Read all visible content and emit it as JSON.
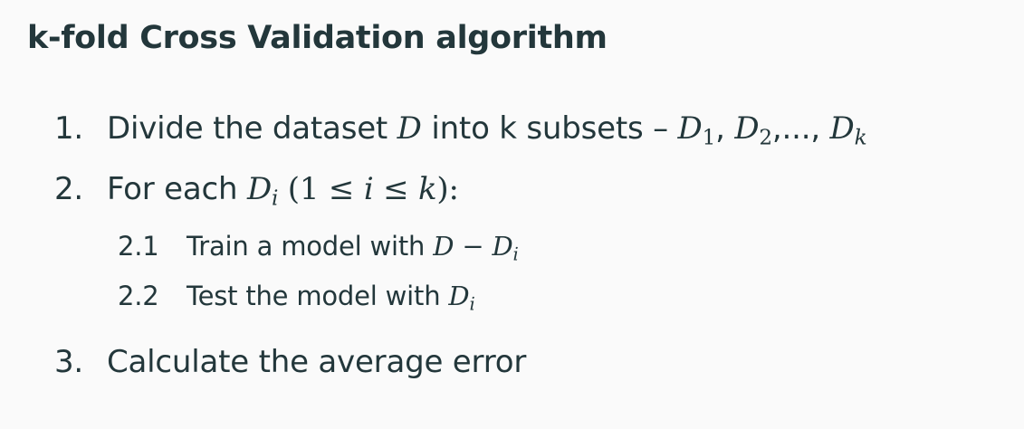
{
  "slide": {
    "title": "k-fold Cross Validation algorithm",
    "steps": [
      {
        "number": "1.",
        "text_a": "Divide the dataset ",
        "math_D": "D",
        "text_b": " into k subsets – ",
        "d1": "D",
        "d1_sub": "1",
        "sep1": ", ",
        "d2": "D",
        "d2_sub": "2",
        "ellipsis": ",..., ",
        "dk": "D",
        "dk_sub": "k"
      },
      {
        "number": "2.",
        "text_a": "For each ",
        "di": "D",
        "di_sub": "i",
        "cond_open": " (1 ≤ ",
        "cond_i": "i",
        "cond_le": " ≤ ",
        "cond_k": "k",
        "cond_close": "):",
        "substeps": [
          {
            "number": "2.1",
            "text": "Train a model with ",
            "m1": "D",
            "minus": " − ",
            "m2": "D",
            "m2_sub": "i"
          },
          {
            "number": "2.2",
            "text": "Test the model with ",
            "m1": "D",
            "m1_sub": "i"
          }
        ]
      },
      {
        "number": "3.",
        "text": "Calculate the average error"
      }
    ]
  },
  "colors": {
    "background": "#fafafa",
    "text": "#23373b"
  }
}
